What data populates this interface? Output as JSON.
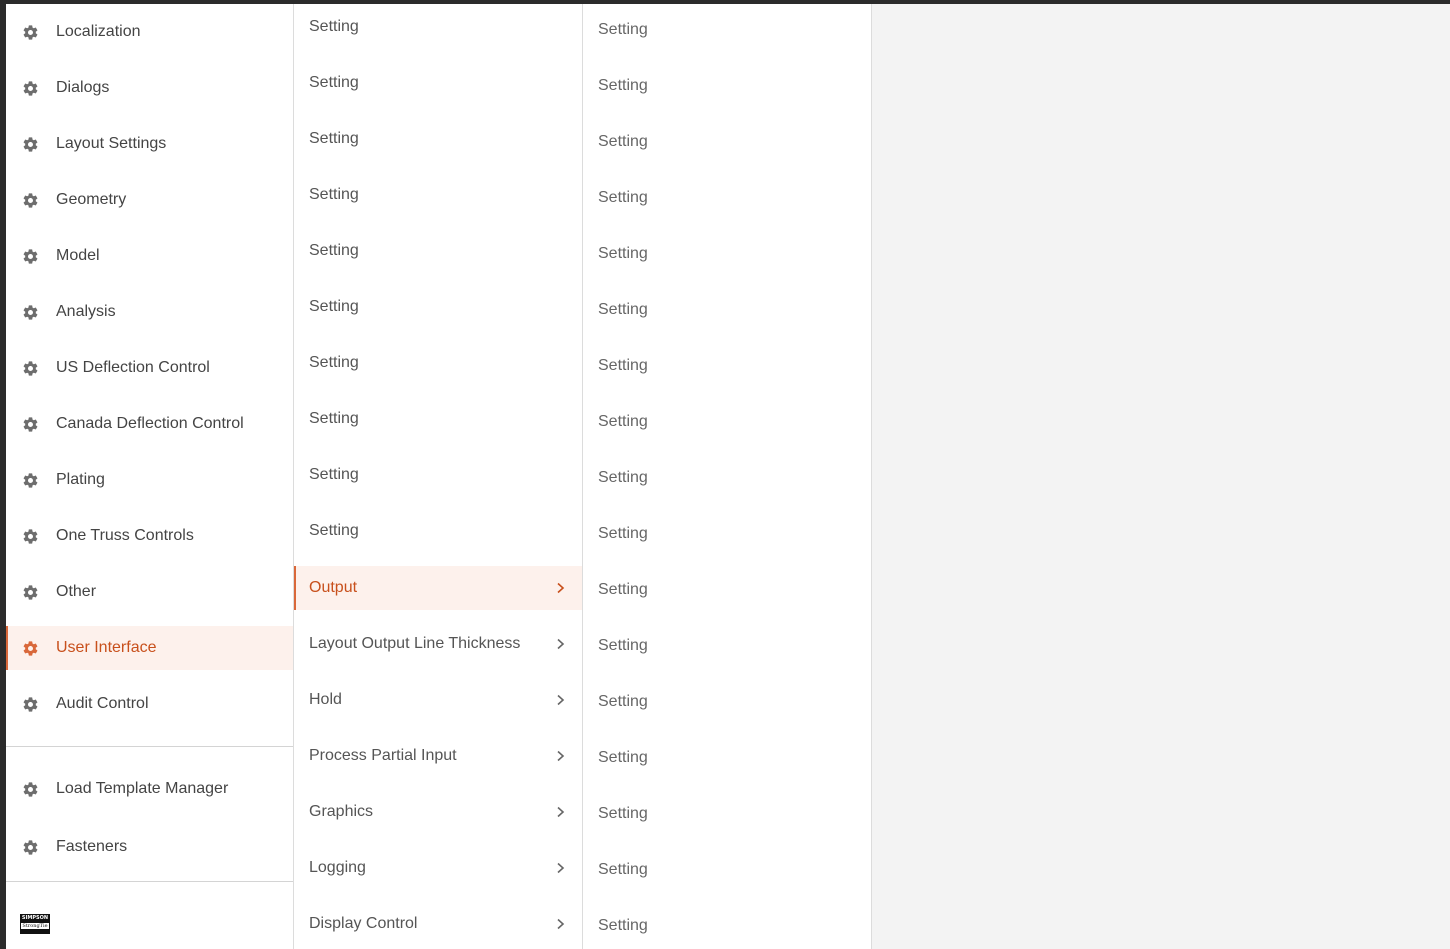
{
  "sidebar": {
    "items": [
      {
        "label": "Localization",
        "icon": "gear-icon"
      },
      {
        "label": "Dialogs",
        "icon": "gear-icon"
      },
      {
        "label": "Layout Settings",
        "icon": "gear-icon"
      },
      {
        "label": "Geometry",
        "icon": "gear-icon"
      },
      {
        "label": "Model",
        "icon": "gear-icon"
      },
      {
        "label": "Analysis",
        "icon": "gear-icon"
      },
      {
        "label": "US Deflection Control",
        "icon": "gear-icon"
      },
      {
        "label": "Canada Deflection Control",
        "icon": "gear-icon"
      },
      {
        "label": "Plating",
        "icon": "gear-icon"
      },
      {
        "label": "One Truss Controls",
        "icon": "gear-icon"
      },
      {
        "label": "Other",
        "icon": "gear-icon"
      },
      {
        "label": "User Interface",
        "icon": "gear-icon",
        "active": true
      },
      {
        "label": "Audit Control",
        "icon": "gear-icon"
      }
    ],
    "secondary_items": [
      {
        "label": "Load Template Manager",
        "icon": "gear-icon"
      },
      {
        "label": "Fasteners",
        "icon": "gear-icon"
      }
    ],
    "logo": {
      "line1": "SIMPSON",
      "line2": "StrongTie"
    }
  },
  "middle": {
    "items": [
      {
        "label": "Setting"
      },
      {
        "label": "Setting"
      },
      {
        "label": "Setting"
      },
      {
        "label": "Setting"
      },
      {
        "label": "Setting"
      },
      {
        "label": "Setting"
      },
      {
        "label": "Setting"
      },
      {
        "label": "Setting"
      },
      {
        "label": "Setting"
      },
      {
        "label": "Setting"
      },
      {
        "label": "Output",
        "chevron": true,
        "active": true
      },
      {
        "label": "Layout Output Line Thickness",
        "chevron": true
      },
      {
        "label": "Hold",
        "chevron": true
      },
      {
        "label": "Process Partial Input",
        "chevron": true
      },
      {
        "label": "Graphics",
        "chevron": true
      },
      {
        "label": "Logging",
        "chevron": true
      },
      {
        "label": "Display Control",
        "chevron": true
      }
    ]
  },
  "settings": {
    "items": [
      "Setting",
      "Setting",
      "Setting",
      "Setting",
      "Setting",
      "Setting",
      "Setting",
      "Setting",
      "Setting",
      "Setting",
      "Setting",
      "Setting",
      "Setting",
      "Setting",
      "Setting",
      "Setting",
      "Setting"
    ]
  },
  "colors": {
    "accent": "#c8501c",
    "active_bg": "#fdf1ec",
    "text": "#444444",
    "empty_panel": "#f3f3f3"
  }
}
